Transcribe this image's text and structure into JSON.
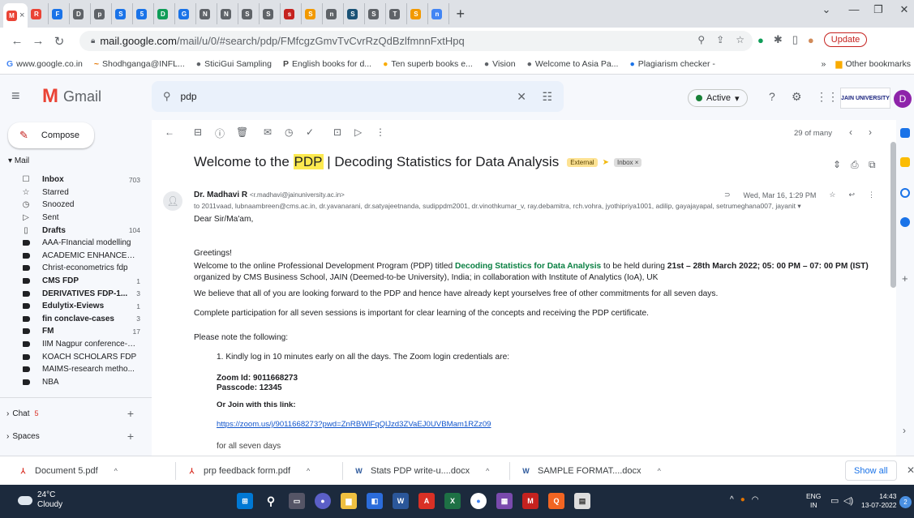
{
  "browser": {
    "tabs": [
      {
        "label": "M",
        "color": "#ea4335",
        "active": true
      },
      {
        "label": "R",
        "color": "#ea4335"
      },
      {
        "label": "F",
        "color": "#1a73e8"
      },
      {
        "label": "D",
        "color": "#5f6368"
      },
      {
        "label": "p",
        "color": "#5f6368"
      },
      {
        "label": "S",
        "color": "#1a73e8"
      },
      {
        "label": "5",
        "color": "#1a73e8"
      },
      {
        "label": "D",
        "color": "#0f9d58"
      },
      {
        "label": "G",
        "color": "#1a73e8"
      },
      {
        "label": "N",
        "color": "#5f6368"
      },
      {
        "label": "N",
        "color": "#5f6368"
      },
      {
        "label": "S",
        "color": "#5f6368"
      },
      {
        "label": "S",
        "color": "#5f6368"
      },
      {
        "label": "s",
        "color": "#c5221f"
      },
      {
        "label": "S",
        "color": "#f29900"
      },
      {
        "label": "n",
        "color": "#5f6368"
      },
      {
        "label": "S",
        "color": "#1a5276"
      },
      {
        "label": "S",
        "color": "#5f6368"
      },
      {
        "label": "T",
        "color": "#5f6368"
      },
      {
        "label": "S",
        "color": "#f29900"
      },
      {
        "label": "n",
        "color": "#4285f4"
      }
    ],
    "active_tab_close": "×",
    "new_tab": "+",
    "url_host": "mail.google.com",
    "url_path": "/mail/u/0/#search/pdp/FMfcgzGmvTvCvrRzQdBzlfmnnFxtHpq",
    "update_label": "Update",
    "bookmarks": [
      {
        "label": "www.google.co.in",
        "icon": "G",
        "color": "#4285f4"
      },
      {
        "label": "Shodhganga@INFL...",
        "icon": "~",
        "color": "#e37400"
      },
      {
        "label": "SticiGui Sampling",
        "icon": "●",
        "color": "#5f6368"
      },
      {
        "label": "English books for d...",
        "icon": "P",
        "color": "#444"
      },
      {
        "label": "Ten superb books e...",
        "icon": "●",
        "color": "#f9ab00"
      },
      {
        "label": "Vision",
        "icon": "●",
        "color": "#5f6368"
      },
      {
        "label": "Welcome to Asia Pa...",
        "icon": "●",
        "color": "#5f6368"
      },
      {
        "label": "Plagiarism checker -",
        "icon": "●",
        "color": "#1a73e8"
      }
    ],
    "bookmarks_more": "»",
    "other_bookmarks": "Other bookmarks"
  },
  "gmail": {
    "logo_text": "Gmail",
    "search_query": "pdp",
    "status_label": "Active",
    "org_logo": "JAIN UNIVERSITY",
    "avatar_letter": "D",
    "compose_label": "Compose",
    "mail_section": "Mail",
    "folders": [
      {
        "label": "Inbox",
        "count": "703",
        "icon": "☐",
        "bold": true
      },
      {
        "label": "Starred",
        "count": "",
        "icon": "☆"
      },
      {
        "label": "Snoozed",
        "count": "",
        "icon": "◷"
      },
      {
        "label": "Sent",
        "count": "",
        "icon": "▷"
      },
      {
        "label": "Drafts",
        "count": "104",
        "icon": "▯",
        "bold": true
      },
      {
        "label": "AAA-FInancial modelling",
        "count": "",
        "label_dot": true
      },
      {
        "label": "ACADEMIC ENHANCEM...",
        "count": "",
        "label_dot": true
      },
      {
        "label": "Christ-econometrics fdp",
        "count": "",
        "label_dot": true
      },
      {
        "label": "CMS FDP",
        "count": "1",
        "label_dot": true,
        "bold": true
      },
      {
        "label": "DERIVATIVES FDP-1...",
        "count": "3",
        "label_dot": true,
        "bold": true
      },
      {
        "label": "Edulytix-Eviews",
        "count": "1",
        "label_dot": true,
        "bold": true
      },
      {
        "label": "fin conclave-cases",
        "count": "3",
        "label_dot": true,
        "bold": true
      },
      {
        "label": "FM",
        "count": "17",
        "label_dot": true,
        "bold": true
      },
      {
        "label": "IIM Nagpur conference-2...",
        "count": "",
        "label_dot": true
      },
      {
        "label": "KOACH SCHOLARS FDP",
        "count": "",
        "label_dot": true
      },
      {
        "label": "MAIMS-research metho...",
        "count": "",
        "label_dot": true
      },
      {
        "label": "NBA",
        "count": "",
        "label_dot": true
      }
    ],
    "chat_label": "Chat",
    "chat_count": "5",
    "spaces_label": "Spaces",
    "pager": "29 of many",
    "subject_before": "Welcome to the ",
    "subject_highlight": "PDP",
    "subject_after": " | Decoding Statistics for Data Analysis",
    "badge_external": "External",
    "badge_inbox": "Inbox ×",
    "sender_name": "Dr. Madhavi R",
    "sender_email": "<r.madhavi@jainuniversity.ac.in>",
    "recipients": "to 2011vaad, lubnaambreen@cms.ac.in, dr.yavanarani, dr.satyajeetnanda, sudippdm2001, dr.vinothkumar_v, ray.debamitra, rch.vohra, jyothipriya1001, adilip, gayajayapal, setrumeghana007, jayanit ▾",
    "date": "Wed, Mar 16, 1:29 PM",
    "body": {
      "salutation": "Dear Sir/Ma'am,",
      "greeting": "Greetings!",
      "intro_1": "Welcome to the online Professional Development Program (PDP) titled ",
      "intro_title": "Decoding Statistics for Data Analysis",
      "intro_2": "  to be held during ",
      "intro_dates": "21st – 28th March 2022",
      "intro_3": "; 05: 00 PM – 07: 00 PM (IST)",
      "intro_line2": "organized by CMS Business School, JAIN (Deemed-to-be University), India; in collaboration with Institute of Analytics (IoA), UK",
      "para_believe": "We believe that all of you are looking forward to the PDP and hence have already kept yourselves free of other commitments for all seven days.",
      "para_complete": "Complete participation for all seven sessions is important for clear learning of the concepts and receiving the PDP certificate.",
      "note": "Please note the following:",
      "item_1": "1.   Kindly log in 10 minutes early on all the days. The Zoom login credentials are:",
      "zoom_id": "Zoom Id: 9011668273",
      "passcode": "Passcode: 12345",
      "or_join": "Or Join with this link:",
      "link": "https://zoom.us/j/9011668273?pwd=ZnRBWlFqQlJzd3ZVaEJ0UVBMam1RZz09",
      "tail": "for all seven days"
    }
  },
  "downloads": [
    {
      "name": "Document 5.pdf",
      "type": "pdf"
    },
    {
      "name": "prp feedback form.pdf",
      "type": "pdf"
    },
    {
      "name": "Stats PDP write-u....docx",
      "type": "docx"
    },
    {
      "name": "SAMPLE FORMAT....docx",
      "type": "docx"
    }
  ],
  "show_all_label": "Show all",
  "taskbar": {
    "temperature": "24°C",
    "weather": "Cloudy",
    "lang_1": "ENG",
    "lang_2": "IN",
    "time": "14:43",
    "date": "13-07-2022",
    "notifications": "2"
  },
  "colors": {
    "gmail_red": "#ea4335",
    "accent_blue": "#1a73e8",
    "external_badge": "#fde293",
    "highlight": "#fce94f",
    "taskbar": "#1c2a3d"
  }
}
